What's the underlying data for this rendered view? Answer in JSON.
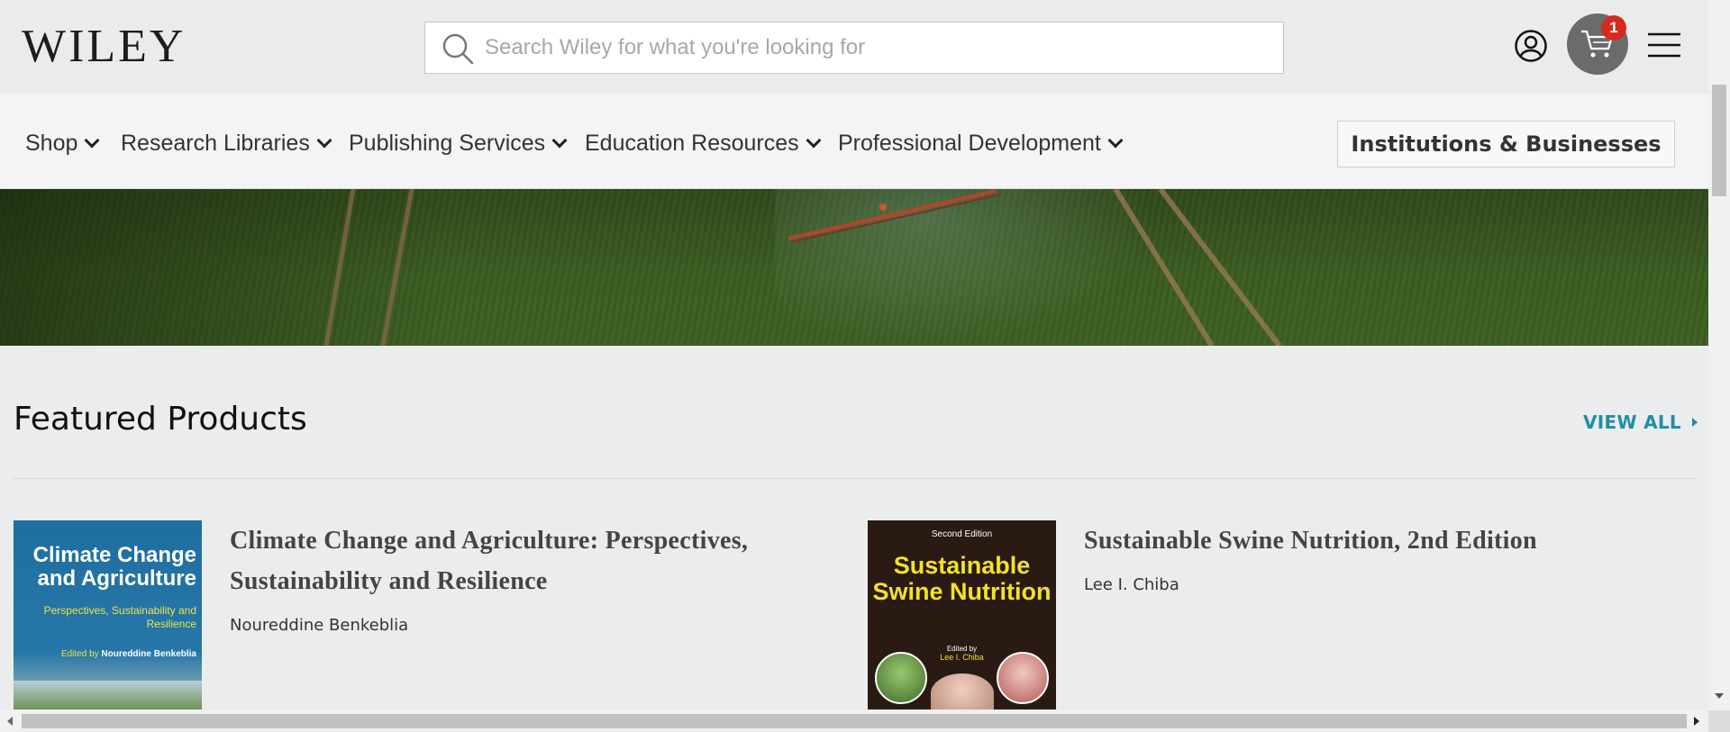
{
  "header": {
    "logo_text": "WILEY",
    "search_placeholder": "Search Wiley for what you're looking for",
    "cart_count": "1",
    "icons": [
      "search-icon",
      "account-icon",
      "cart-icon",
      "hamburger-menu-icon"
    ]
  },
  "nav": {
    "items": [
      {
        "label": "Shop"
      },
      {
        "label": "Research Libraries"
      },
      {
        "label": "Publishing Services"
      },
      {
        "label": "Education Resources"
      },
      {
        "label": "Professional Development"
      }
    ],
    "cta_label": "Institutions & Businesses"
  },
  "featured": {
    "title": "Featured Products",
    "view_all_label": "VIEW ALL",
    "accent_color": "#1f8fa5",
    "products": [
      {
        "title": "Climate Change and Agriculture: Perspectives, Sustainability and Resilience",
        "author": "Noureddine Benkeblia",
        "cover": {
          "title": "Climate Change and Agriculture",
          "subtitle": "Perspectives, Sustainability and Resilience",
          "edited_by": "Edited by",
          "editor": "Noureddine Benkeblia"
        }
      },
      {
        "title": "Sustainable Swine Nutrition, 2nd Edition",
        "author": "Lee I. Chiba",
        "cover": {
          "edition": "Second Edition",
          "title": "Sustainable Swine Nutrition",
          "edited_by": "Edited by",
          "editor": "Lee I. Chiba"
        }
      }
    ]
  }
}
